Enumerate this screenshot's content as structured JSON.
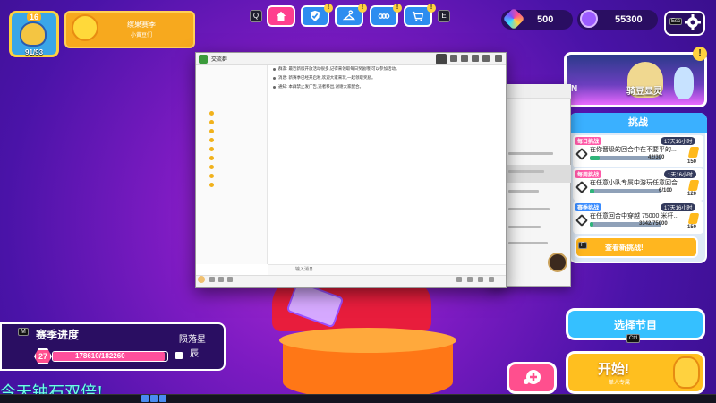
{
  "player": {
    "level": "16",
    "xp": "91/93"
  },
  "event": {
    "title": "缤果赛季",
    "subtitle": "小黄豆们"
  },
  "nav": {
    "left_key": "Q",
    "right_key": "E",
    "buttons": [
      {
        "name": "home",
        "icon": "home-icon",
        "notif": ""
      },
      {
        "name": "challenges",
        "icon": "shield-check-icon",
        "notif": "!"
      },
      {
        "name": "customize",
        "icon": "hanger-icon",
        "notif": "!"
      },
      {
        "name": "party",
        "icon": "link-icon",
        "notif": "!"
      },
      {
        "name": "store",
        "icon": "cart-icon",
        "notif": "!"
      }
    ]
  },
  "currency": {
    "gems": "500",
    "kudos": "55300"
  },
  "settings": {
    "key": "Esc",
    "icon": "gear-icon"
  },
  "promo": {
    "key": "N",
    "label": "骑豆显灵",
    "badge": "!"
  },
  "challenges": {
    "title": "挑战",
    "items": [
      {
        "tag": "每日挑战",
        "timer": "17天16小时",
        "text": "在你晋级的回合中在不要平的...",
        "progress": "42/300",
        "reward": "150",
        "pct": 0.14
      },
      {
        "tag": "每周挑战",
        "timer": "1天16小时",
        "text": "在任意小队专属中游玩任意回合",
        "progress": "6/100",
        "reward": "120",
        "pct": 0.06
      },
      {
        "tag": "赛季挑战",
        "timer": "17天16小时",
        "text": "在任意回合中穿越 75000 米杆...",
        "progress": "3342/75000",
        "reward": "150",
        "pct": 0.045
      }
    ],
    "view_key": "F",
    "view_label": "查看新挑战!"
  },
  "select_show": {
    "label": "选择节目",
    "key": "Ctrl"
  },
  "start": {
    "label": "开始!",
    "sub": "单人专属"
  },
  "season": {
    "key": "M",
    "title": "赛季进度",
    "level": "27",
    "xp": "178610/182260",
    "fill": 0.98,
    "next_line1": "陨落星",
    "next_line2": "辰"
  },
  "banner": "今天钟石双倍!",
  "chat_window": {
    "title": "交流群",
    "messages": [
      "群友: 最近新版开放活动很多,记得来领取每日奖励哦,可以参加活动。",
      "消息: 新赛季已经开启啦,欢迎大家来玩,一起领取奖励。",
      "通知: 本群禁止发广告,违者移出,谢谢大家配合。"
    ],
    "input_placeholder": "输入消息..."
  },
  "colors": {
    "accent": "#ff4f8e",
    "brand_blue": "#35c0ff",
    "gold": "#ffbf1f"
  }
}
